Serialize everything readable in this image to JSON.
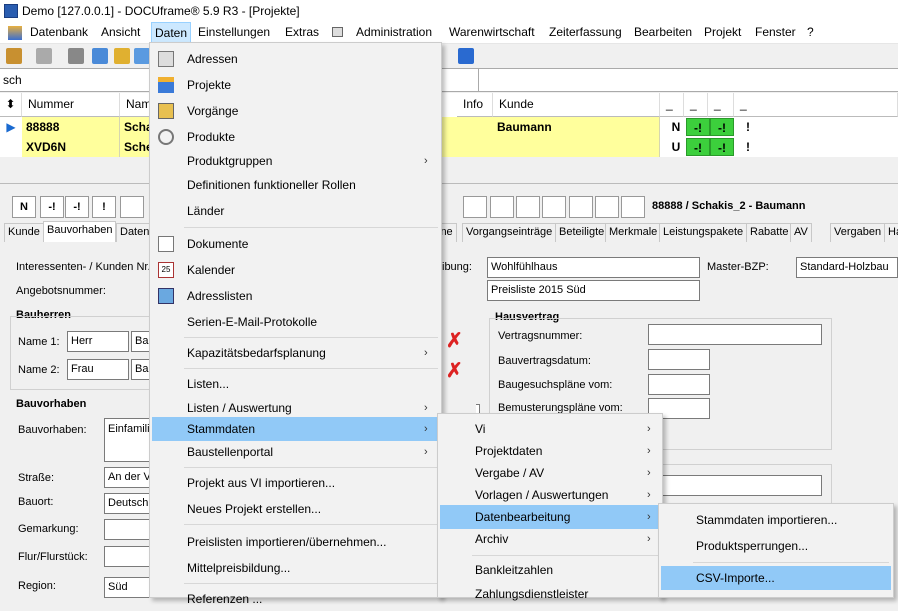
{
  "title": "Demo [127.0.0.1] - DOCUframe® 5.9 R3 - [Projekte]",
  "menubar": [
    "Datenbank",
    "Ansicht",
    "Daten",
    "Einstellungen",
    "Extras",
    "Administration",
    "Warenwirtschaft",
    "Zeiterfassung",
    "Bearbeiten",
    "Projekt",
    "Fenster",
    "?"
  ],
  "search": {
    "value": "sch"
  },
  "grid": {
    "headers": [
      "Nummer",
      "Nam",
      "Info",
      "Kunde",
      "_",
      "_",
      "_",
      "_"
    ],
    "rows": [
      {
        "nummer": "88888",
        "name": "Scha",
        "kunde": "Baumann",
        "status": "N",
        "s1": "-!",
        "s2": "-!",
        "s3": "!"
      },
      {
        "nummer": "XVD6N",
        "name": "Sche",
        "kunde": "",
        "status": "U",
        "s1": "-!",
        "s2": "-!",
        "s3": "!"
      }
    ]
  },
  "detail": {
    "status": "N",
    "s1": "-!",
    "s2": "-!",
    "s3": "!",
    "header": "88888 / Schakis_2 - Baumann",
    "tabs": [
      "Kunde",
      "Bauvorhaben",
      "Daten",
      "ine",
      "Vorgangseinträge",
      "Beteiligte",
      "Merkmale",
      "Leistungspakete",
      "Rabatte",
      "AV",
      "Vergaben",
      "Ha"
    ],
    "labels": {
      "interessent": "Interessenten- / Kunden Nr.",
      "angebot": "Angebotsnummer:",
      "beschr": "ibung:",
      "master": "Master-BZP:",
      "bauherren": "Bauherren",
      "name1": "Name 1:",
      "name2": "Name 2:",
      "bauvorhaben_g": "Bauvorhaben",
      "bauvorhaben": "Bauvorhaben:",
      "strasse": "Straße:",
      "bauort": "Bauort:",
      "gemarkung": "Gemarkung:",
      "flur": "Flur/Flurstück:",
      "region": "Region:",
      "hausvertrag": "Hausvertrag",
      "vertragsnr": "Vertragsnummer:",
      "bauvertragsdatum": "Bauvertragsdatum:",
      "baugesuch": "Baugesuchspläne vom:",
      "bemusterung": "Bemusterungspläne vom:"
    },
    "values": {
      "beschr": "Wohlfühlhaus",
      "preisliste": "Preisliste 2015 Süd",
      "master": "Standard-Holzbau",
      "anrede1": "Herr",
      "name1": "Ba",
      "anrede2": "Frau",
      "name2": "Ba",
      "bauvorhaben": "Einfamili",
      "strasse": "An der V",
      "bauort": "Deutsch",
      "region": "Süd"
    }
  },
  "menu_daten": {
    "items": [
      "Adressen",
      "Projekte",
      "Vorgänge",
      "Produkte",
      "Produktgruppen",
      "Definitionen funktioneller Rollen",
      "Länder",
      "Dokumente",
      "Kalender",
      "Adresslisten",
      "Serien-E-Mail-Protokolle",
      "Kapazitätsbedarfsplanung",
      "Listen...",
      "Listen / Auswertung",
      "Stammdaten",
      "Baustellenportal",
      "Projekt aus VI importieren...",
      "Neues Projekt erstellen...",
      "Preislisten importieren/übernehmen...",
      "Mittelpreisbildung...",
      "Referenzen ..."
    ]
  },
  "menu_stammdaten": {
    "items": [
      "Vi",
      "Projektdaten",
      "Vergabe / AV",
      "Vorlagen / Auswertungen",
      "Datenbearbeitung",
      "Archiv",
      "Bankleitzahlen",
      "Zahlungsdienstleister"
    ]
  },
  "menu_datenbearbeitung": {
    "items": [
      "Stammdaten importieren...",
      "Produktsperrungen...",
      "CSV-Importe..."
    ]
  }
}
